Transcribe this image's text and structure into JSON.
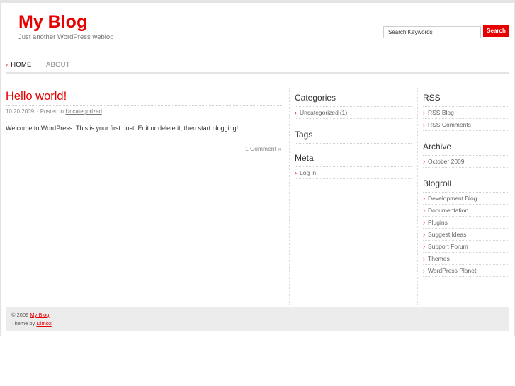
{
  "header": {
    "blog_title": "My Blog",
    "tagline": "Just another WordPress weblog"
  },
  "search": {
    "value": "Search Keywords",
    "button_label": "Search"
  },
  "nav": {
    "items": [
      {
        "label": "HOME",
        "active": true
      },
      {
        "label": "ABOUT",
        "active": false
      }
    ]
  },
  "post": {
    "title": "Hello world!",
    "date": "10.20.2009",
    "posted_in_label": "Posted in",
    "category": "Uncategorized",
    "body": "Welcome to WordPress. This is your first post. Edit or delete it, then start blogging! ...",
    "comments_link": "1 Comment »"
  },
  "sidebar_left": {
    "categories": {
      "title": "Categories",
      "items": [
        {
          "label": "Uncategorized",
          "count": "(1)"
        }
      ]
    },
    "tags": {
      "title": "Tags"
    },
    "meta": {
      "title": "Meta",
      "items": [
        {
          "label": "Log in"
        }
      ]
    }
  },
  "sidebar_right": {
    "rss": {
      "title": "RSS",
      "items": [
        {
          "label": "RSS Blog"
        },
        {
          "label": "RSS Comments"
        }
      ]
    },
    "archive": {
      "title": "Archive",
      "items": [
        {
          "label": "October 2009"
        }
      ]
    },
    "blogroll": {
      "title": "Blogroll",
      "items": [
        {
          "label": "Development Blog"
        },
        {
          "label": "Documentation"
        },
        {
          "label": "Plugins"
        },
        {
          "label": "Suggest Ideas"
        },
        {
          "label": "Support Forum"
        },
        {
          "label": "Themes"
        },
        {
          "label": "WordPress Planet"
        }
      ]
    }
  },
  "footer": {
    "copyright_prefix": "© 2009",
    "copyright_link": "My Blog",
    "theme_prefix": "Theme by",
    "theme_link": "Dimox"
  },
  "colors": {
    "accent": "#e60000",
    "footer_bg": "#ececec"
  },
  "icons": {
    "bullet": "chevron-right-icon"
  }
}
